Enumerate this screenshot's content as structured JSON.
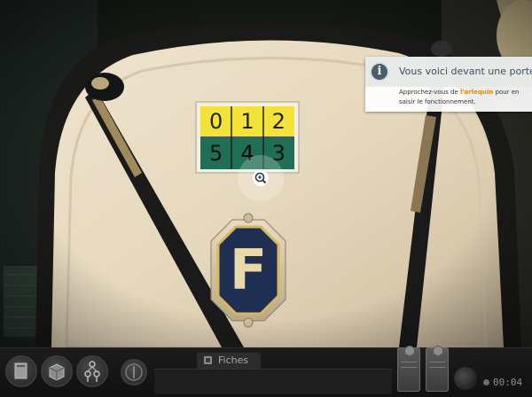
{
  "info": {
    "icon": "info-icon",
    "title": "Vous voici devant une porte.",
    "text_before": "Approchez-vous de ",
    "highlight": "l'arlequin",
    "text_after": " pour en saisir le fonctionnement.",
    "highlight_color": "#e08a00"
  },
  "arlequin": {
    "top_row": [
      "0",
      "1",
      "2"
    ],
    "bottom_row": [
      "5",
      "4",
      "3"
    ],
    "top_color": "#f2e23a",
    "bottom_color": "#1f6e55"
  },
  "plaque": {
    "letter": "F"
  },
  "hotspot": {
    "icon": "zoom-in-icon"
  },
  "toolbar": {
    "buttons": [
      "book-icon",
      "box-icon",
      "keys-icon",
      "compass-icon"
    ],
    "fiches_label": "Fiches",
    "timer": "00:04"
  }
}
